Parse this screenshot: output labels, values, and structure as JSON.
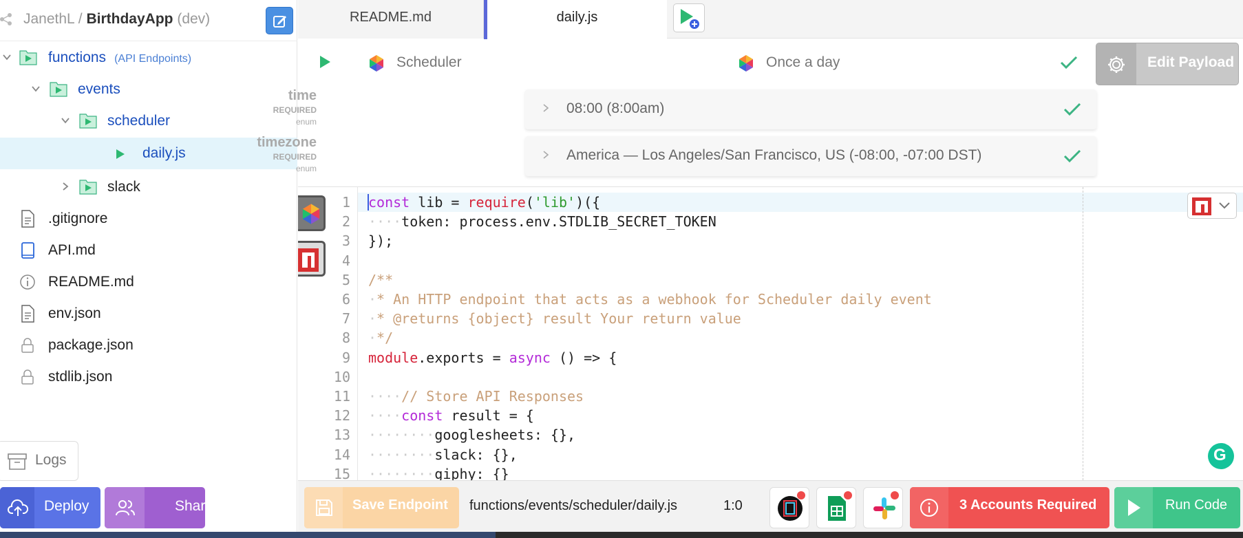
{
  "header": {
    "owner": "JanethL",
    "separator": "/",
    "app_name": "BirthdayApp",
    "env": "(dev)"
  },
  "tree": {
    "functions": {
      "label": "functions",
      "note": "(API Endpoints)"
    },
    "events": {
      "label": "events"
    },
    "scheduler": {
      "label": "scheduler"
    },
    "daily": {
      "label": "daily.js"
    },
    "slack": {
      "label": "slack"
    }
  },
  "files": [
    {
      "label": ".gitignore",
      "icon": "file-icon"
    },
    {
      "label": "API.md",
      "icon": "book-icon"
    },
    {
      "label": "README.md",
      "icon": "info-icon"
    },
    {
      "label": "env.json",
      "icon": "file-icon"
    },
    {
      "label": "package.json",
      "icon": "lock-icon"
    },
    {
      "label": "stdlib.json",
      "icon": "lock-icon"
    }
  ],
  "sidebar_buttons": {
    "logs": "Logs",
    "deploy": "Deploy",
    "share": "Share"
  },
  "tabs": [
    {
      "label": "README.md"
    },
    {
      "label": "daily.js",
      "active": true
    }
  ],
  "trigger": {
    "source": "Scheduler",
    "frequency": "Once a day",
    "edit_payload": "Edit Payload"
  },
  "params": [
    {
      "name": "time",
      "required": "REQUIRED",
      "type": "enum",
      "value": "08:00 (8:00am)"
    },
    {
      "name": "timezone",
      "required": "REQUIRED",
      "type": "enum",
      "value": "America — Los Angeles/San Francisco, US (-08:00, -07:00 DST)"
    }
  ],
  "editor": {
    "line_numbers": [
      "1",
      "2",
      "3",
      "4",
      "5",
      "6",
      "7",
      "8",
      "9",
      "10",
      "11",
      "12",
      "13",
      "14",
      "15"
    ],
    "lines": [
      [
        [
          "kw",
          "const"
        ],
        [
          "",
          "lib = "
        ],
        [
          "fn",
          "require"
        ],
        [
          "",
          "("
        ],
        [
          "str",
          "'lib'"
        ],
        [
          "",
          ")({"
        ]
      ],
      [
        [
          "ws",
          "····"
        ],
        [
          "",
          "token: process.env.STDLIB_SECRET_TOKEN"
        ]
      ],
      [
        [
          "",
          "});"
        ]
      ],
      [],
      [
        [
          "cm",
          "/**"
        ]
      ],
      [
        [
          "ws",
          "·"
        ],
        [
          "cm",
          "* An HTTP endpoint that acts as a webhook for Scheduler daily event"
        ]
      ],
      [
        [
          "ws",
          "·"
        ],
        [
          "cm",
          "* @returns {object} result Your return value"
        ]
      ],
      [
        [
          "ws",
          "·"
        ],
        [
          "cm",
          "*/"
        ]
      ],
      [
        [
          "fn",
          "module"
        ],
        [
          "",
          ".exports = "
        ],
        [
          "kw",
          "async"
        ],
        [
          "",
          ""
        ],
        [
          "",
          ""
        ],
        [
          "",
          ""
        ],
        [
          "",
          ""
        ],
        [
          "",
          ""
        ],
        [
          "",
          ""
        ],
        [
          "",
          ""
        ],
        [
          "",
          ""
        ],
        [
          "",
          ""
        ],
        [
          "",
          "() => {"
        ]
      ],
      [],
      [
        [
          "ws",
          "····"
        ],
        [
          "cm",
          "// Store API Responses"
        ]
      ],
      [
        [
          "ws",
          "····"
        ],
        [
          "kw",
          "const"
        ],
        [
          "",
          ""
        ],
        [
          "",
          ""
        ],
        [
          "",
          ""
        ],
        [
          "",
          ""
        ],
        [
          "",
          ""
        ],
        [
          "",
          ""
        ],
        [
          "",
          ""
        ],
        [
          "",
          ""
        ],
        [
          "",
          ""
        ],
        [
          "",
          ""
        ],
        [
          "",
          ""
        ],
        [
          "",
          ""
        ],
        [
          "",
          ""
        ],
        [
          "",
          ""
        ],
        [
          "",
          ""
        ],
        [
          "",
          ""
        ],
        [
          "",
          ""
        ],
        [
          "",
          ""
        ],
        [
          "",
          ""
        ],
        [
          "",
          ""
        ],
        [
          "",
          ""
        ],
        [
          "",
          ""
        ],
        [
          "",
          ""
        ],
        [
          "",
          ""
        ],
        [
          "",
          ""
        ],
        [
          "",
          ""
        ],
        [
          "",
          ""
        ],
        [
          "",
          ""
        ],
        [
          "",
          "result = {"
        ]
      ],
      [
        [
          "ws",
          "········"
        ],
        [
          "",
          "googlesheets: {},"
        ]
      ],
      [
        [
          "ws",
          "········"
        ],
        [
          "",
          "slack: {},"
        ]
      ],
      [
        [
          "ws",
          "········"
        ],
        [
          "",
          "giphy: {}"
        ]
      ]
    ]
  },
  "bottom": {
    "save": "Save Endpoint",
    "path": "functions/events/scheduler/daily.js",
    "cursor": "1:0",
    "integrations": [
      "notion-icon",
      "google-sheets-icon",
      "slack-icon"
    ],
    "accounts": "3 Accounts Required",
    "run": "Run Code"
  },
  "colors": {
    "accent_blue": "#4a90e2",
    "deploy": "#5a73e6",
    "share": "#9f5fd0",
    "save": "#fbd5a5",
    "accounts": "#f05252",
    "run": "#3fc58a",
    "check": "#3cb483"
  }
}
